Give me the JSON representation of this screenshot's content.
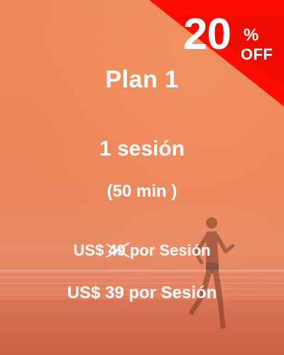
{
  "badge": {
    "number": "20",
    "percent": "%",
    "off": "OFF",
    "color": "#fd0c04"
  },
  "plan": {
    "title": "Plan 1",
    "sessions": "1 sesión",
    "duration": "(50 min )"
  },
  "pricing": {
    "old_prefix": "US$ ",
    "old_value": "49",
    "old_suffix": " por Sesión",
    "new_price": "US$ 39 por Sesión"
  },
  "theme": {
    "overlay": "#ee8a5a",
    "text": "#ffffff"
  }
}
